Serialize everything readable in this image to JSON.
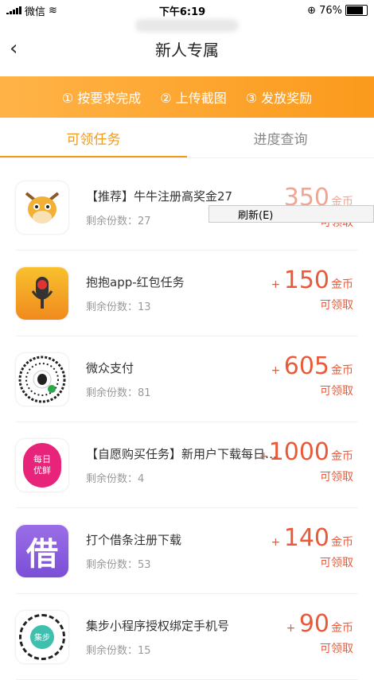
{
  "status_bar": {
    "carrier": "微信",
    "time": "下午6:19",
    "battery": "76%"
  },
  "header": {
    "back": "‹",
    "title": "新人专属"
  },
  "steps": [
    "① 按要求完成",
    "② 上传截图",
    "③ 发放奖励"
  ],
  "tabs": [
    {
      "label": "可领任务"
    },
    {
      "label": "进度查询"
    }
  ],
  "context_menu": {
    "refresh": "刷新(E)"
  },
  "tasks": [
    {
      "title": "【推荐】牛牛注册高奖金27",
      "remain": "剩余份数：27",
      "value": "350",
      "unit": "金币",
      "claim": "可领取"
    },
    {
      "title": "抱抱app-红包任务",
      "remain": "剩余份数：13",
      "value": "150",
      "unit": "金币",
      "claim": "可领取"
    },
    {
      "title": "微众支付",
      "remain": "剩余份数：81",
      "value": "605",
      "unit": "金币",
      "claim": "可领取"
    },
    {
      "title": "【自愿购买任务】新用户下载每日…",
      "remain": "剩余份数：4",
      "value": "1000",
      "unit": "金币",
      "claim": "可领取"
    },
    {
      "title": "打个借条注册下载",
      "remain": "剩余份数：53",
      "value": "140",
      "unit": "金币",
      "claim": "可领取"
    },
    {
      "title": "集步小程序授权绑定手机号",
      "remain": "剩余份数：15",
      "value": "90",
      "unit": "金币",
      "claim": "可领取"
    }
  ],
  "icon_texts": {
    "meiri_line1": "每日",
    "meiri_line2": "优鲜",
    "jie": "借",
    "jibu": "集步"
  }
}
